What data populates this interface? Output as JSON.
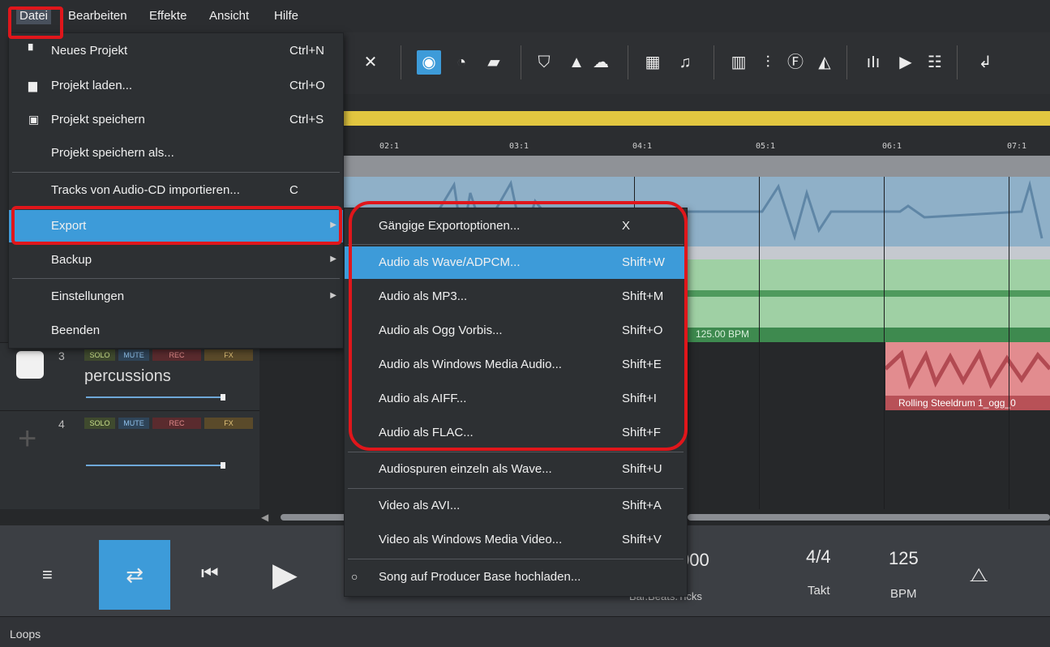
{
  "menubar": {
    "items": [
      "Datei",
      "Bearbeiten",
      "Effekte",
      "Ansicht",
      "Hilfe"
    ]
  },
  "file_menu": {
    "items": [
      {
        "label": "Neues Projekt",
        "shortcut": "Ctrl+N",
        "icon": "document-icon"
      },
      {
        "label": "Projekt laden...",
        "shortcut": "Ctrl+O",
        "icon": "folder-icon"
      },
      {
        "label": "Projekt speichern",
        "shortcut": "Ctrl+S",
        "icon": "floppy-icon"
      },
      {
        "label": "Projekt speichern als...",
        "shortcut": ""
      },
      {
        "label": "Tracks von Audio-CD importieren...",
        "shortcut": "C"
      },
      {
        "label": "Export",
        "shortcut": "",
        "submenu": true,
        "highlighted": true
      },
      {
        "label": "Backup",
        "shortcut": "",
        "submenu": true
      },
      {
        "label": "Einstellungen",
        "shortcut": "",
        "submenu": true
      },
      {
        "label": "Beenden",
        "shortcut": ""
      }
    ]
  },
  "export_menu": {
    "items": [
      {
        "label": "Gängige Exportoptionen...",
        "shortcut": "X"
      },
      {
        "label": "Audio als Wave/ADPCM...",
        "shortcut": "Shift+W",
        "highlighted": true
      },
      {
        "label": "Audio als MP3...",
        "shortcut": "Shift+M"
      },
      {
        "label": "Audio als Ogg Vorbis...",
        "shortcut": "Shift+O"
      },
      {
        "label": "Audio als Windows Media Audio...",
        "shortcut": "Shift+E"
      },
      {
        "label": "Audio als AIFF...",
        "shortcut": "Shift+I"
      },
      {
        "label": "Audio als FLAC...",
        "shortcut": "Shift+F"
      },
      {
        "label": "Audiospuren einzeln als Wave...",
        "shortcut": "Shift+U"
      },
      {
        "label": "Video als AVI...",
        "shortcut": "Shift+A"
      },
      {
        "label": "Video als Windows Media Video...",
        "shortcut": "Shift+V"
      },
      {
        "label": "Song auf Producer Base hochladen...",
        "shortcut": "",
        "icon": "upload-circle-icon"
      }
    ]
  },
  "ruler": {
    "marks": [
      "02:1",
      "03:1",
      "04:1",
      "05:1",
      "06:1",
      "07:1"
    ]
  },
  "tracks": [
    {
      "number": "3",
      "name": "percussions",
      "solo": "SOLO",
      "mute": "MUTE",
      "rec": "REC",
      "fx": "FX"
    },
    {
      "number": "4",
      "name": "",
      "solo": "SOLO",
      "mute": "MUTE",
      "rec": "REC",
      "fx": "FX"
    }
  ],
  "clips": {
    "bpm_label": "125.00 BPM",
    "track3_clip": "Rolling Steeldrum 1_ogg_0"
  },
  "transport": {
    "position": "000",
    "position_label": "Bar.Beats.Ticks",
    "time_signature": "4/4",
    "time_signature_label": "Takt",
    "tempo": "125",
    "tempo_label": "BPM"
  },
  "status": {
    "label": "Loops"
  },
  "colors": {
    "highlight": "#3d9bd9",
    "annotation_red": "#e0161b",
    "timeline_yellow": "#e2c640"
  }
}
